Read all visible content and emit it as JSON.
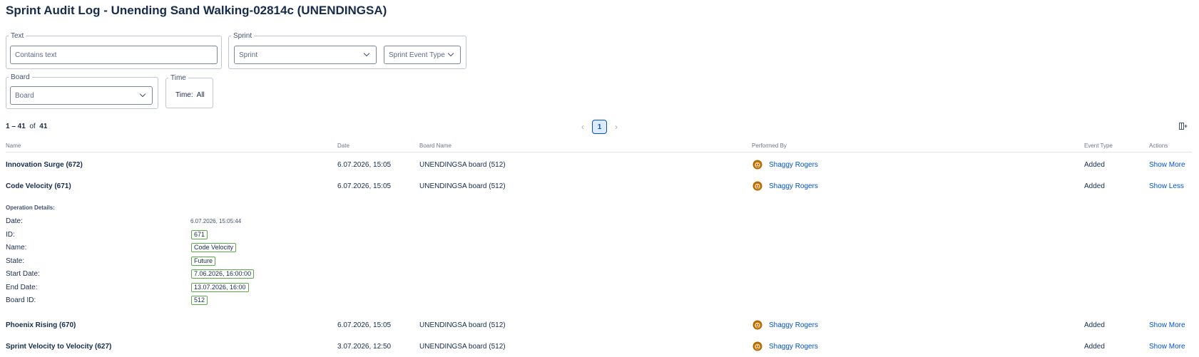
{
  "page": {
    "title": "Sprint Audit Log - Unending Sand Walking-02814c (UNENDINGSA)"
  },
  "filters": {
    "text": {
      "legend": "Text",
      "placeholder": "Contains text"
    },
    "sprint": {
      "legend": "Sprint",
      "sprint_placeholder": "Sprint",
      "event_type_placeholder": "Sprint Event Type"
    },
    "board": {
      "legend": "Board",
      "placeholder": "Board"
    },
    "time": {
      "legend": "Time",
      "label": "Time:",
      "value": "All"
    }
  },
  "pagination": {
    "range": "1 – 41",
    "of": "of",
    "total": "41",
    "current_page": "1",
    "prev_icon": "chevron-left-icon",
    "next_icon": "chevron-right-icon"
  },
  "toolbar": {
    "columns_icon": "column-settings-icon"
  },
  "table": {
    "headers": {
      "name": "Name",
      "date": "Date",
      "board_name": "Board Name",
      "performed_by": "Performed By",
      "event_type": "Event Type",
      "actions": "Actions"
    },
    "rows": [
      {
        "name": "Innovation Surge (672)",
        "date": "6.07.2026, 15:05",
        "board": "UNENDINGSA board (512)",
        "user": "Shaggy Rogers",
        "event": "Added",
        "action": "Show More"
      },
      {
        "name": "Code Velocity (671)",
        "date": "6.07.2026, 15:05",
        "board": "UNENDINGSA board (512)",
        "user": "Shaggy Rogers",
        "event": "Added",
        "action": "Show Less"
      },
      {
        "name": "Phoenix Rising (670)",
        "date": "6.07.2026, 15:05",
        "board": "UNENDINGSA board (512)",
        "user": "Shaggy Rogers",
        "event": "Added",
        "action": "Show More"
      },
      {
        "name": "Sprint Velocity to Velocity (627)",
        "date": "3.07.2026, 12:50",
        "board": "UNENDINGSA board (512)",
        "user": "Shaggy Rogers",
        "event": "Added",
        "action": "Show More"
      }
    ]
  },
  "details": {
    "title": "Operation Details:",
    "date_label": "Date:",
    "date_value": "6.07.2026, 15:05:44",
    "id_label": "ID:",
    "id_value": "671",
    "name_label": "Name:",
    "name_value": "Code Velocity",
    "state_label": "State:",
    "state_value": "Future",
    "start_label": "Start Date:",
    "start_value": "7.06.2026, 16:00:00",
    "end_label": "End Date:",
    "end_value": "13.07.2026, 16:00",
    "board_label": "Board ID:",
    "board_value": "512"
  },
  "colors": {
    "link": "#0052cc",
    "badge_border": "#5aac44",
    "text": "#172b4d"
  }
}
